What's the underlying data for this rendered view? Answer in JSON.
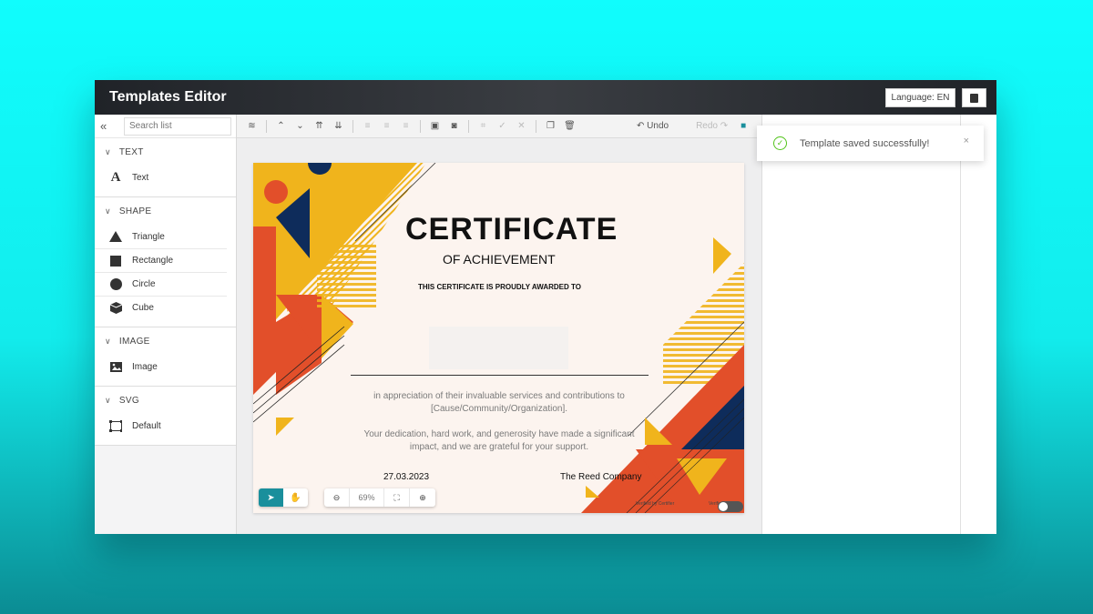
{
  "window": {
    "title": "Templates Editor"
  },
  "header": {
    "language_label": "Language: EN",
    "book_icon": "book-icon"
  },
  "sidebar": {
    "collapse_icon": "double-chevron-left-icon",
    "search_placeholder": "Search list",
    "groups": [
      {
        "title": "TEXT",
        "items": [
          {
            "label": "Text",
            "icon": "text-icon"
          }
        ]
      },
      {
        "title": "SHAPE",
        "items": [
          {
            "label": "Triangle",
            "icon": "triangle-icon"
          },
          {
            "label": "Rectangle",
            "icon": "square-icon"
          },
          {
            "label": "Circle",
            "icon": "circle-icon"
          },
          {
            "label": "Cube",
            "icon": "cube-icon"
          }
        ]
      },
      {
        "title": "IMAGE",
        "items": [
          {
            "label": "Image",
            "icon": "image-icon"
          }
        ]
      },
      {
        "title": "SVG",
        "items": [
          {
            "label": "Default",
            "icon": "vector-icon"
          }
        ]
      }
    ]
  },
  "toolbar": {
    "undo_label": "Undo",
    "redo_label": "Redo"
  },
  "certificate": {
    "title": "CERTIFICATE",
    "subtitle": "OF ACHIEVEMENT",
    "awarded_line": "THIS CERTIFICATE IS PROUDLY AWARDED TO",
    "paragraph1": "in appreciation of their invaluable services and contributions to [Cause/Community/Organization].",
    "paragraph2": "Your dedication, hard work, and generosity have made a significant impact, and we are grateful for your support.",
    "date": "27.03.2023",
    "company": "The Reed Company",
    "footer_left": "Verified by Certifier",
    "footer_right": "Verified"
  },
  "canvas_controls": {
    "zoom_value": "69%"
  },
  "toast": {
    "message": "Template saved successfully!",
    "close": "×"
  },
  "colors": {
    "accent": "#1a8f9c",
    "orange": "#f0b41c",
    "red": "#e24f2a",
    "navy": "#0e2c5b"
  }
}
